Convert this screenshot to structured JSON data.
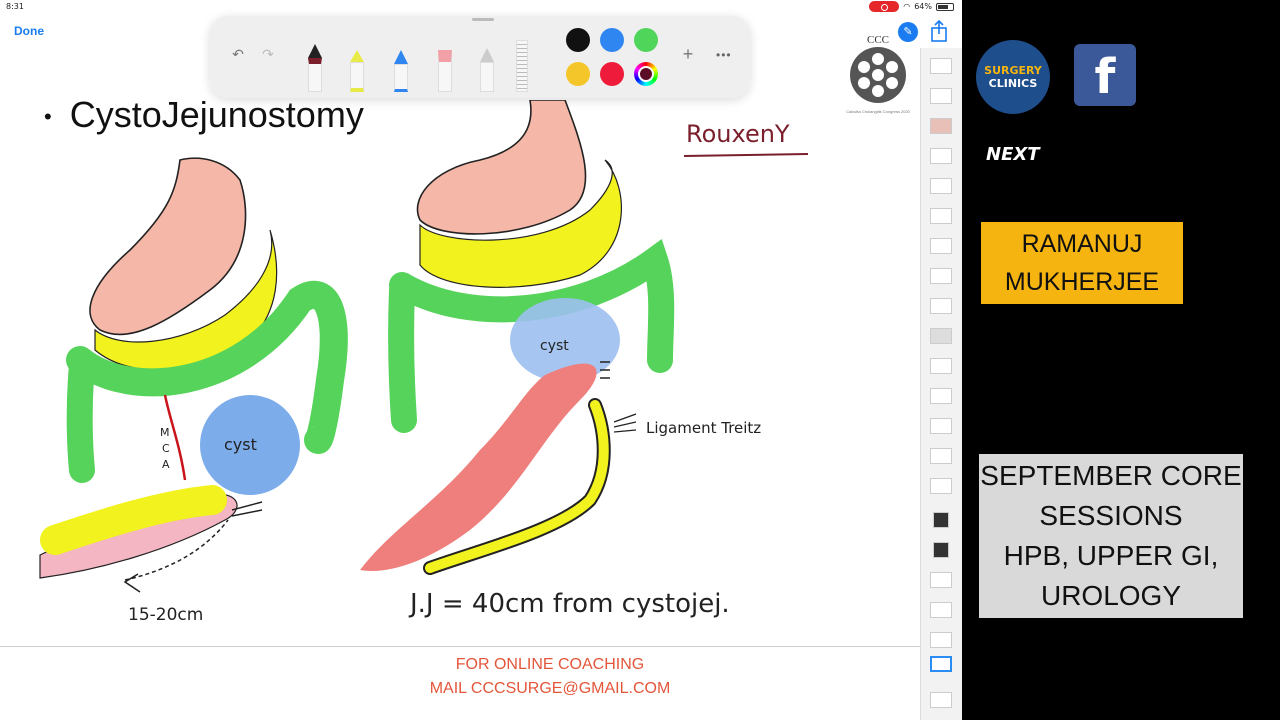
{
  "status_bar": {
    "time": "8:31",
    "battery": "64%"
  },
  "nav": {
    "done_label": "Done"
  },
  "toolbar": {
    "undo_icon": "undo-icon",
    "redo_icon": "redo-icon",
    "add_icon": "plus-icon",
    "more_icon": "ellipsis-icon",
    "colors": [
      "#111111",
      "#2f86f0",
      "#4fd65a",
      "#f5c62a",
      "#ee1c3a",
      "#5a0d24"
    ]
  },
  "slide": {
    "title": "CystoJejunostomy",
    "annotations": {
      "roux": "RouxenY",
      "cyst_left": "cyst",
      "cyst_right": "cyst",
      "mca_m": "M",
      "mca_c": "C",
      "mca_a": "A",
      "ligament": "Ligament Treitz",
      "distance": "15-20cm",
      "jj": "J.J = 40cm from cystojej."
    },
    "logo": {
      "text": "CCC",
      "subtitle": "Calcutta Cholangitis Congress 2020"
    },
    "footer": {
      "line1": "FOR ONLINE COACHING",
      "line2": "MAIL CCCSURGE@GMAIL.COM"
    }
  },
  "right_panel": {
    "surgery_logo": {
      "line1": "SURGERY",
      "line2": "CLINICS"
    },
    "facebook_logo": "f",
    "next_label": "NEXT",
    "presenter": {
      "line1": "RAMANUJ",
      "line2": "MUKHERJEE"
    },
    "session": {
      "line1": "SEPTEMBER CORE",
      "line2": "SESSIONS",
      "line3": "HPB, UPPER GI,",
      "line4": "UROLOGY"
    }
  }
}
